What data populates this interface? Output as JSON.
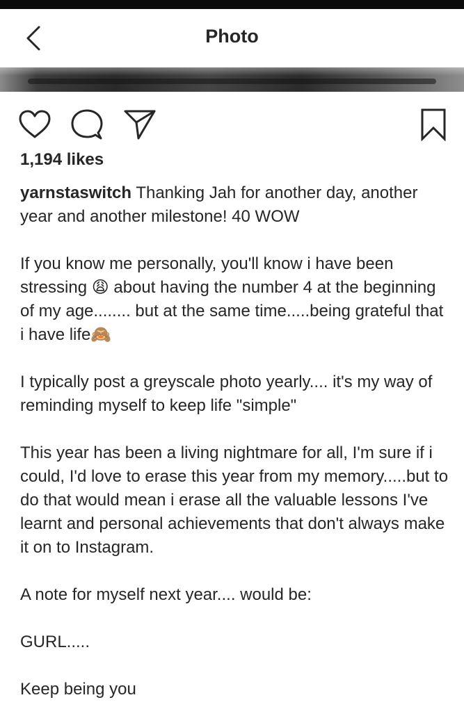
{
  "header": {
    "title": "Photo",
    "back_icon": "chevron-left-icon"
  },
  "actions": {
    "like_icon": "heart-outline-icon",
    "comment_icon": "comment-bubble-icon",
    "share_icon": "paper-plane-icon",
    "save_icon": "bookmark-icon"
  },
  "post": {
    "likes": "1,194 likes",
    "username": "yarnstaswitch",
    "caption_line1": " Thanking Jah for another day, another year and another milestone! 40 WOW",
    "paragraph2": "If you know me personally, you'll know i have been stressing 😩 about having the number 4 at the beginning of my age........ but at the same time.....being grateful that i have life🙈",
    "paragraph3": "I typically post a greyscale photo yearly.... it's my way of reminding myself to keep life \"simple\"",
    "paragraph4": "This year has been a living nightmare for all, I'm sure if i could, I'd love to erase this year from my memory.....but to do that would mean i erase all the valuable lessons I've learnt and personal achievements that don't always make it on to Instagram.",
    "paragraph5": "A note for myself next year.... would be:",
    "paragraph6": "GURL.....",
    "paragraph7": "Keep being you"
  },
  "colors": {
    "text": "#262626",
    "background": "#ffffff",
    "status_bar": "#0a0a0a"
  }
}
